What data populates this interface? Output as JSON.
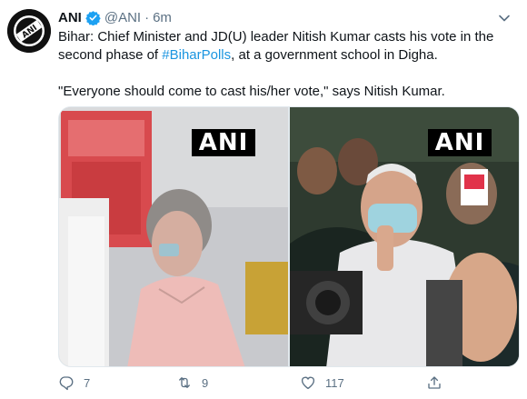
{
  "account": {
    "name": "ANI",
    "handle": "@ANI",
    "separator": "·",
    "time": "6m",
    "avatar_text": "ANI",
    "verified_color": "#1da1f2"
  },
  "tweet": {
    "line1_prefix": "Bihar: Chief Minister and JD(U) leader Nitish Kumar casts his vote in the second phase of ",
    "hashtag": "#BiharPolls",
    "line1_suffix": ", at a government school in Digha.",
    "quote": "\"Everyone should come to cast his/her vote,\" says Nitish Kumar.",
    "link_color": "#1b95e0"
  },
  "media": {
    "left": {
      "watermark": "ANI"
    },
    "right": {
      "watermark": "ANI"
    }
  },
  "actions": {
    "reply": {
      "icon": "reply-icon",
      "count": "7"
    },
    "retweet": {
      "icon": "retweet-icon",
      "count": "9"
    },
    "like": {
      "icon": "heart-icon",
      "count": "117"
    },
    "share": {
      "icon": "share-icon",
      "count": ""
    }
  }
}
